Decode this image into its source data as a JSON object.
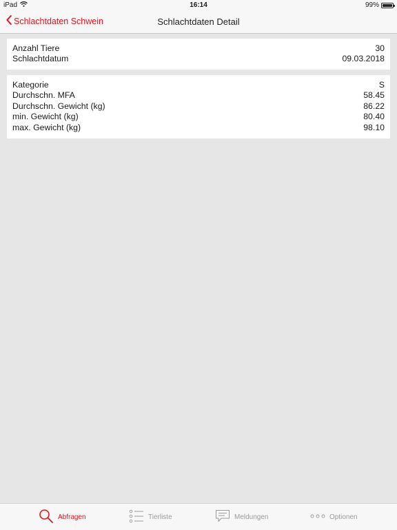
{
  "status_bar": {
    "carrier": "iPad",
    "time": "16:14",
    "battery": "99%",
    "battery_level": 0.99
  },
  "navbar": {
    "back_label": "Schlachtdaten Schwein",
    "title": "Schlachtdaten Detail"
  },
  "summary": [
    {
      "label": "Anzahl Tiere",
      "value": "30"
    },
    {
      "label": "Schlachtdatum",
      "value": "09.03.2018"
    }
  ],
  "details": [
    {
      "label": "Kategorie",
      "value": "S"
    },
    {
      "label": "Durchschn. MFA",
      "value": "58.45"
    },
    {
      "label": "Durchschn. Gewicht (kg)",
      "value": "86.22"
    },
    {
      "label": "min. Gewicht (kg)",
      "value": "80.40"
    },
    {
      "label": "max. Gewicht (kg)",
      "value": "98.10"
    }
  ],
  "tabbar": {
    "tabs": [
      {
        "label": "Abfragen",
        "icon": "search-icon",
        "active": true
      },
      {
        "label": "Tierliste",
        "icon": "list-icon",
        "active": false
      },
      {
        "label": "Meldungen",
        "icon": "message-icon",
        "active": false
      },
      {
        "label": "Optionen",
        "icon": "more-icon",
        "active": false
      }
    ]
  },
  "colors": {
    "accent": "#e3141b",
    "background": "#e6e6e6",
    "card": "#ffffff",
    "inactive": "#9a9a9a"
  }
}
